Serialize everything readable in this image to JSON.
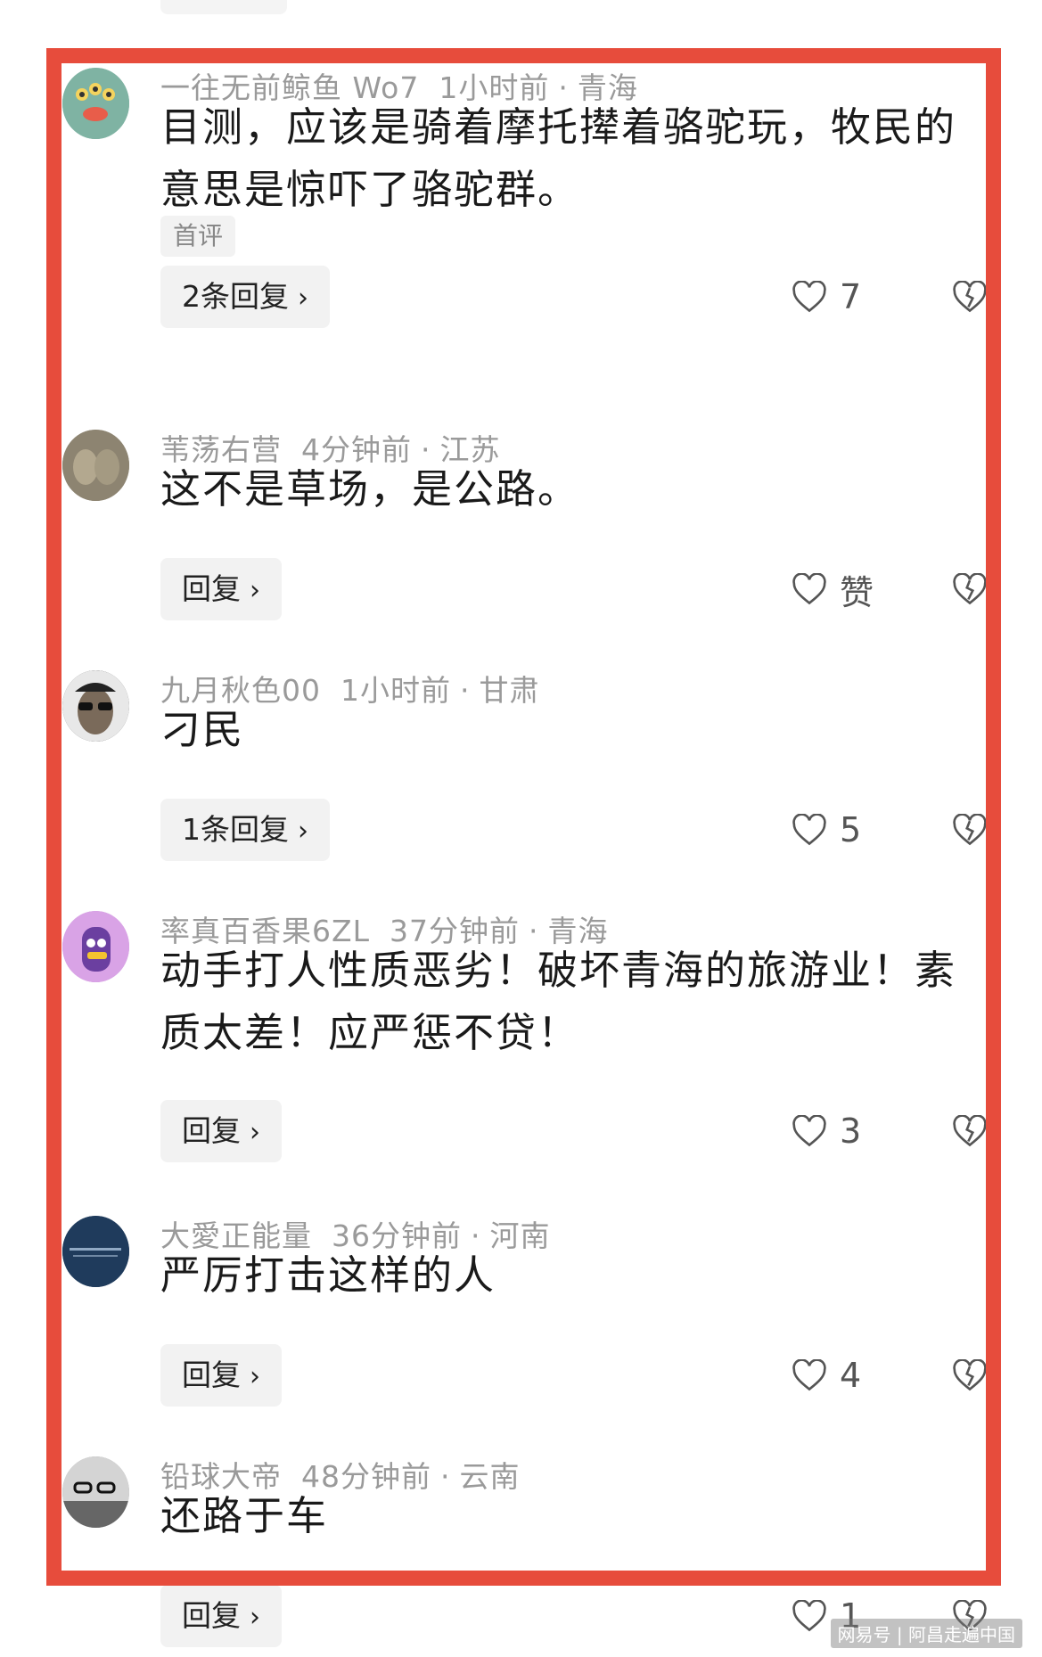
{
  "comments": [
    {
      "username": "一往无前鲸鱼 Wo7",
      "time": "1小时前",
      "location": "青海",
      "text": "目测，应该是骑着摩托撵着骆驼玩，牧民的意思是惊吓了骆驼群。",
      "tag": "首评",
      "reply_label": "2条回复",
      "likes": "7",
      "avatar_color": "#7fb3a3"
    },
    {
      "username": "苇荡右营",
      "time": "4分钟前",
      "location": "江苏",
      "text": "这不是草场，是公路。",
      "reply_label": "回复",
      "likes": "赞",
      "avatar_color": "#8d8471"
    },
    {
      "username": "九月秋色00",
      "time": "1小时前",
      "location": "甘肃",
      "text": "刁民",
      "reply_label": "1条回复",
      "likes": "5",
      "avatar_color": "#3a3a3a"
    },
    {
      "username": "率真百香果6ZL",
      "time": "37分钟前",
      "location": "青海",
      "text": "动手打人性质恶劣！破坏青海的旅游业！素质太差！应严惩不贷！",
      "reply_label": "回复",
      "likes": "3",
      "avatar_color": "#c98ad9"
    },
    {
      "username": "大愛正能量",
      "time": "36分钟前",
      "location": "河南",
      "text": "严厉打击这样的人",
      "reply_label": "回复",
      "likes": "4",
      "avatar_color": "#1f3b5c"
    },
    {
      "username": "铅球大帝",
      "time": "48分钟前",
      "location": "云南",
      "text": "还路于车",
      "reply_label": "回复",
      "likes": "1",
      "avatar_color": "#9a9a9a"
    }
  ],
  "separator": "·",
  "watermark": "网易号 | 阿昌走遍中国",
  "highlight_color": "#e74c3c"
}
